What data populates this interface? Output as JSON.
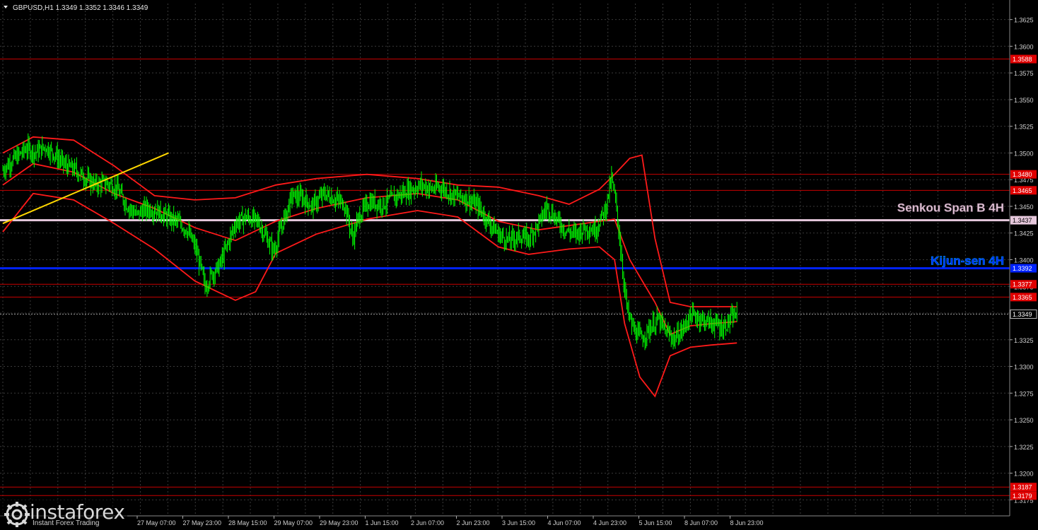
{
  "header": {
    "symbol_line": "GBPUSD,H1  1.3349 1.3352 1.3346 1.3349"
  },
  "logo": {
    "name": "instaforex",
    "tagline": "Instant Forex Trading"
  },
  "colors": {
    "background": "#000000",
    "grid": "#3a3a3a",
    "candles": "#00ff00",
    "bands": "#ff1a1a",
    "levels": "#c80000",
    "kijun": "#0022ff",
    "senkou": "#e6c8dc",
    "trendline": "#ffd700",
    "axis_text": "#d0d0d0"
  },
  "chart_data": {
    "type": "line",
    "title": "GBPUSD,H1",
    "ylim": [
      1.316,
      1.364
    ],
    "yticks": [
      "1.3625",
      "1.3600",
      "1.3575",
      "1.3550",
      "1.3525",
      "1.3500",
      "1.3475",
      "1.3450",
      "1.3425",
      "1.3400",
      "1.3375",
      "1.3350",
      "1.3325",
      "1.3300",
      "1.3275",
      "1.3250",
      "1.3225",
      "1.3200",
      "1.3175"
    ],
    "xticks": [
      "27 May 07:00",
      "27 May 23:00",
      "28 May 15:00",
      "29 May 07:00",
      "29 May 23:00",
      "1 Jun 15:00",
      "2 Jun 07:00",
      "2 Jun 23:00",
      "3 Jun 15:00",
      "4 Jun 07:00",
      "4 Jun 23:00",
      "5 Jun 15:00",
      "8 Jun 07:00",
      "8 Jun 23:00"
    ],
    "current_price": {
      "label": "1.3349",
      "value": 1.3349
    },
    "levels": [
      {
        "label": "1.3588",
        "value": 1.3588
      },
      {
        "label": "1.3480",
        "value": 1.348
      },
      {
        "label": "1.3465",
        "value": 1.3465
      },
      {
        "label": "1.3377",
        "value": 1.3377
      },
      {
        "label": "1.3365",
        "value": 1.3365
      },
      {
        "label": "1.3187",
        "value": 1.3187
      },
      {
        "label": "1.3179",
        "value": 1.3179
      }
    ],
    "senkou_span_b": {
      "name": "Senkou Span B 4H",
      "label": "1.3437",
      "value": 1.3437
    },
    "kijun_sen": {
      "name": "Kijun-sen 4H",
      "label": "1.3392",
      "value": 1.3392
    },
    "trendline": [
      [
        0,
        1.3434
      ],
      [
        164,
        1.35
      ]
    ],
    "price_path": [
      [
        0,
        1.3484
      ],
      [
        8,
        1.3492
      ],
      [
        16,
        1.3498
      ],
      [
        24,
        1.3505
      ],
      [
        32,
        1.35
      ],
      [
        42,
        1.3506
      ],
      [
        52,
        1.3498
      ],
      [
        62,
        1.3488
      ],
      [
        72,
        1.3484
      ],
      [
        82,
        1.3476
      ],
      [
        92,
        1.347
      ],
      [
        102,
        1.3472
      ],
      [
        112,
        1.3468
      ],
      [
        122,
        1.3452
      ],
      [
        132,
        1.3442
      ],
      [
        142,
        1.3448
      ],
      [
        152,
        1.3446
      ],
      [
        162,
        1.344
      ],
      [
        172,
        1.3436
      ],
      [
        182,
        1.3428
      ],
      [
        190,
        1.3412
      ],
      [
        196,
        1.3392
      ],
      [
        200,
        1.3374
      ],
      [
        206,
        1.3386
      ],
      [
        214,
        1.3394
      ],
      [
        222,
        1.3414
      ],
      [
        230,
        1.3434
      ],
      [
        240,
        1.344
      ],
      [
        252,
        1.3436
      ],
      [
        262,
        1.3418
      ],
      [
        268,
        1.3408
      ],
      [
        276,
        1.3432
      ],
      [
        286,
        1.346
      ],
      [
        296,
        1.3458
      ],
      [
        306,
        1.345
      ],
      [
        318,
        1.3462
      ],
      [
        330,
        1.3456
      ],
      [
        338,
        1.3452
      ],
      [
        346,
        1.342
      ],
      [
        352,
        1.344
      ],
      [
        362,
        1.3454
      ],
      [
        376,
        1.3452
      ],
      [
        390,
        1.346
      ],
      [
        404,
        1.3466
      ],
      [
        414,
        1.347
      ],
      [
        424,
        1.3466
      ],
      [
        434,
        1.3468
      ],
      [
        446,
        1.346
      ],
      [
        458,
        1.3458
      ],
      [
        470,
        1.345
      ],
      [
        480,
        1.3436
      ],
      [
        490,
        1.3424
      ],
      [
        500,
        1.3418
      ],
      [
        510,
        1.3422
      ],
      [
        520,
        1.342
      ],
      [
        530,
        1.3434
      ],
      [
        538,
        1.345
      ],
      [
        546,
        1.344
      ],
      [
        556,
        1.3428
      ],
      [
        566,
        1.3424
      ],
      [
        576,
        1.343
      ],
      [
        586,
        1.3428
      ],
      [
        596,
        1.3448
      ],
      [
        602,
        1.3476
      ],
      [
        606,
        1.3454
      ],
      [
        610,
        1.342
      ],
      [
        614,
        1.338
      ],
      [
        618,
        1.335
      ],
      [
        624,
        1.3334
      ],
      [
        632,
        1.3326
      ],
      [
        640,
        1.3336
      ],
      [
        648,
        1.3344
      ],
      [
        656,
        1.3332
      ],
      [
        664,
        1.3326
      ],
      [
        672,
        1.3334
      ],
      [
        680,
        1.3348
      ],
      [
        688,
        1.3346
      ],
      [
        696,
        1.3342
      ],
      [
        704,
        1.334
      ],
      [
        712,
        1.3336
      ],
      [
        720,
        1.3344
      ],
      [
        726,
        1.3349
      ]
    ],
    "upper_band": [
      [
        0,
        1.35
      ],
      [
        30,
        1.3515
      ],
      [
        70,
        1.3512
      ],
      [
        110,
        1.3488
      ],
      [
        150,
        1.346
      ],
      [
        190,
        1.3456
      ],
      [
        230,
        1.3458
      ],
      [
        270,
        1.347
      ],
      [
        310,
        1.3476
      ],
      [
        360,
        1.348
      ],
      [
        410,
        1.3476
      ],
      [
        450,
        1.347
      ],
      [
        490,
        1.3468
      ],
      [
        530,
        1.346
      ],
      [
        560,
        1.3452
      ],
      [
        590,
        1.3466
      ],
      [
        605,
        1.348
      ],
      [
        620,
        1.3495
      ],
      [
        632,
        1.3498
      ],
      [
        645,
        1.342
      ],
      [
        660,
        1.336
      ],
      [
        680,
        1.3356
      ],
      [
        700,
        1.3356
      ],
      [
        726,
        1.3356
      ]
    ],
    "middle_line": [
      [
        0,
        1.347
      ],
      [
        30,
        1.349
      ],
      [
        70,
        1.3482
      ],
      [
        110,
        1.3462
      ],
      [
        150,
        1.3448
      ],
      [
        190,
        1.343
      ],
      [
        230,
        1.3418
      ],
      [
        270,
        1.3436
      ],
      [
        310,
        1.3448
      ],
      [
        360,
        1.3458
      ],
      [
        410,
        1.3462
      ],
      [
        450,
        1.3456
      ],
      [
        490,
        1.3436
      ],
      [
        530,
        1.3428
      ],
      [
        560,
        1.3432
      ],
      [
        590,
        1.3436
      ],
      [
        605,
        1.3438
      ],
      [
        620,
        1.34
      ],
      [
        645,
        1.336
      ],
      [
        660,
        1.333
      ],
      [
        680,
        1.3338
      ],
      [
        700,
        1.334
      ],
      [
        726,
        1.3342
      ]
    ],
    "lower_band": [
      [
        0,
        1.3426
      ],
      [
        30,
        1.3462
      ],
      [
        70,
        1.3456
      ],
      [
        110,
        1.3434
      ],
      [
        150,
        1.341
      ],
      [
        190,
        1.338
      ],
      [
        230,
        1.3362
      ],
      [
        250,
        1.337
      ],
      [
        270,
        1.3406
      ],
      [
        310,
        1.3424
      ],
      [
        360,
        1.3438
      ],
      [
        410,
        1.3446
      ],
      [
        450,
        1.344
      ],
      [
        490,
        1.3412
      ],
      [
        520,
        1.3405
      ],
      [
        560,
        1.341
      ],
      [
        590,
        1.3412
      ],
      [
        605,
        1.34
      ],
      [
        615,
        1.334
      ],
      [
        630,
        1.329
      ],
      [
        645,
        1.3272
      ],
      [
        660,
        1.331
      ],
      [
        680,
        1.3318
      ],
      [
        700,
        1.332
      ],
      [
        726,
        1.3322
      ]
    ]
  }
}
